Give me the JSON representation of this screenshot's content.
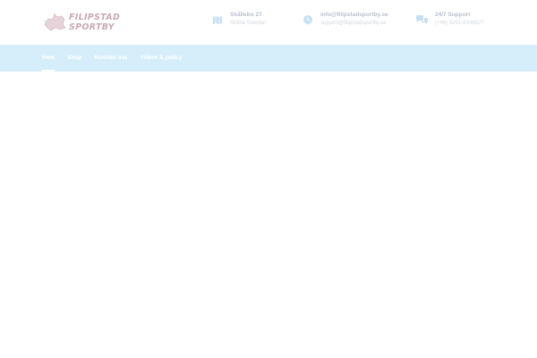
{
  "logo": {
    "text": "FILIPSTAD SPORTBY",
    "icon": "logo-map-icon"
  },
  "contact": [
    {
      "icon": "map-icon",
      "line1": "Skållebo 27",
      "line2": "Skåne Sweden"
    },
    {
      "icon": "clock-icon",
      "line1": "info@filipstadsportby.se",
      "line2": "support@filipstadsportby.se"
    },
    {
      "icon": "chat-icon",
      "line1": "24/7 Support",
      "line2": "(+46) 0291-8346827"
    }
  ],
  "nav": {
    "items": [
      {
        "label": "Hem",
        "active": true
      },
      {
        "label": "Shop",
        "active": false
      },
      {
        "label": "Kontakt oss",
        "active": false
      },
      {
        "label": "Villkor & policy",
        "active": false
      }
    ]
  },
  "colors": {
    "nav_bg": "#d6eefa",
    "logo_text": "#c9a9b4",
    "icon": "#c6dff2"
  }
}
